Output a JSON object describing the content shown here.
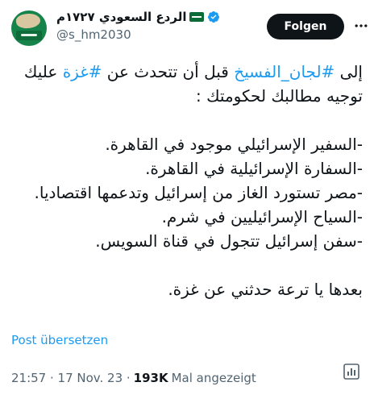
{
  "user": {
    "display_name": "الردع السعودي ١٧٢٧م",
    "handle": "@s_hm2030"
  },
  "follow": {
    "label": "Folgen"
  },
  "tweet": {
    "lines": [
      [
        "إلى ",
        "#لجان_الفسيخ",
        " قبل أن تتحدث عن ",
        "#غزة",
        " عليك"
      ],
      "توجيه مطالبك لحكومتك :",
      "",
      "-السفير الإسرائيلي موجود في القاهرة.",
      "-السفارة الإسرائيلية في القاهرة.",
      "-مصر تستورد الغاز من إسرائيل وتدعمها اقتصاديا.",
      "-السياح الإسرائيليين في شرم.",
      "-سفن إسرائيل تتجول في قناة السويس.",
      "",
      "بعدها يا ترعة حدثني عن غزة."
    ],
    "translate_label": "Post übersetzen"
  },
  "meta": {
    "time_date": "21:57 · 17 Nov. 23 · ",
    "views": "193K",
    "views_label": "Mal angezeigt"
  },
  "colors": {
    "link": "#1d9bf0",
    "verified": "#1d9bf0",
    "button_bg": "#0f1419",
    "secondary_text": "#536471"
  },
  "icons": [
    "verified-badge-icon",
    "saudi-flag-icon",
    "more-icon",
    "analytics-icon"
  ]
}
